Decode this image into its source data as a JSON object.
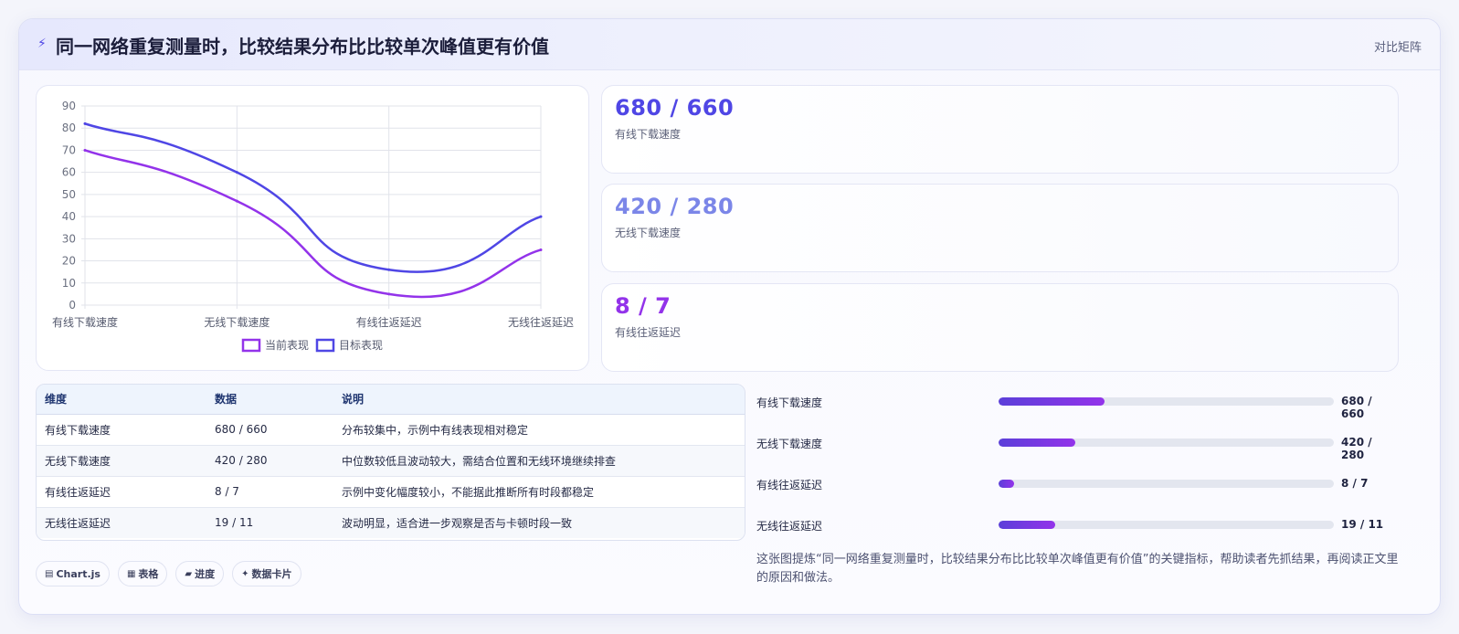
{
  "header": {
    "icon": "lightning-icon",
    "title": "同一网络重复测量时，比较结果分布比比较单次峰值更有价值",
    "link": "对比矩阵"
  },
  "chart_data": {
    "type": "line",
    "categories": [
      "有线下载速度",
      "无线下载速度",
      "有线往返延迟",
      "无线往返延迟"
    ],
    "series": [
      {
        "name": "当前表现",
        "values": [
          70,
          47,
          5,
          25
        ],
        "color": "#9333ea"
      },
      {
        "name": "目标表现",
        "values": [
          82,
          60,
          16,
          40
        ],
        "color": "#4f46e5"
      }
    ],
    "ylim": [
      0,
      90
    ],
    "yticks": [
      "0",
      "10",
      "20",
      "30",
      "40",
      "50",
      "60",
      "70",
      "80",
      "90"
    ],
    "grid": true,
    "legend": "bottom"
  },
  "kpis": [
    {
      "value": "680 / 660",
      "label": "有线下载速度",
      "color": "#4f46e5"
    },
    {
      "value": "420 / 280",
      "label": "无线下载速度",
      "color": "#7b86e8"
    },
    {
      "value": "8 / 7",
      "label": "有线往返延迟",
      "color": "#9333ea"
    }
  ],
  "table": {
    "headers": [
      "维度",
      "数据",
      "说明"
    ],
    "rows": [
      [
        "有线下载速度",
        "680 / 660",
        "分布较集中，示例中有线表现相对稳定"
      ],
      [
        "无线下载速度",
        "420 / 280",
        "中位数较低且波动较大，需结合位置和无线环境继续排查"
      ],
      [
        "有线往返延迟",
        "8 / 7",
        "示例中变化幅度较小，不能据此推断所有时段都稳定"
      ],
      [
        "无线往返延迟",
        "19 / 11",
        "波动明显，适合进一步观察是否与卡顿时段一致"
      ]
    ]
  },
  "progress": [
    {
      "label": "有线下载速度",
      "value": "680 / 660",
      "fraction": 0.315
    },
    {
      "label": "无线下载速度",
      "value": "420 / 280",
      "fraction": 0.23
    },
    {
      "label": "有线往返延迟",
      "value": "8 / 7",
      "fraction": 0.045
    },
    {
      "label": "无线往返延迟",
      "value": "19 / 11",
      "fraction": 0.17
    }
  ],
  "summary": "这张图提炼“同一网络重复测量时，比较结果分布比比较单次峰值更有价值”的关键指标，帮助读者先抓结果，再阅读正文里的原因和做法。",
  "tags": [
    {
      "icon": "chart-icon",
      "glyph": "▤",
      "label": "Chart.js"
    },
    {
      "icon": "table-icon",
      "glyph": "▦",
      "label": "表格"
    },
    {
      "icon": "progress-icon",
      "glyph": "▰",
      "label": "进度"
    },
    {
      "icon": "sparkle-icon",
      "glyph": "✦",
      "label": "数据卡片"
    }
  ]
}
